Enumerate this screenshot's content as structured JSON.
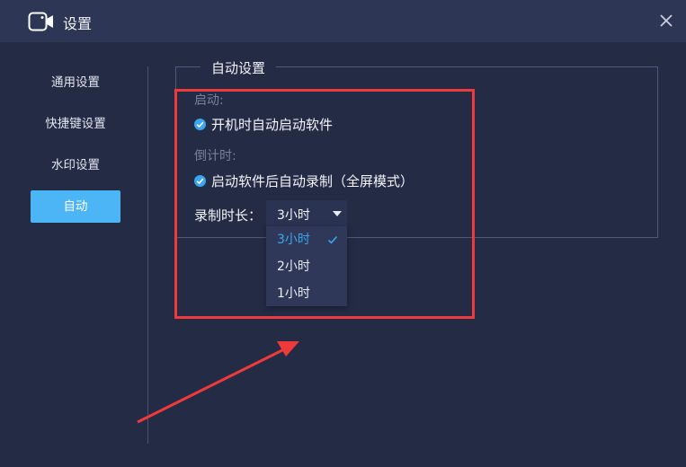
{
  "window": {
    "title": "设置",
    "icon": "video-camera-icon",
    "close_icon": "close-icon"
  },
  "sidebar": {
    "items": [
      {
        "label": "通用设置",
        "active": false
      },
      {
        "label": "快捷键设置",
        "active": false
      },
      {
        "label": "水印设置",
        "active": false
      },
      {
        "label": "自动",
        "active": true
      }
    ]
  },
  "auto_settings": {
    "legend": "自动设置",
    "startup": {
      "section_label": "启动:",
      "option_label": "开机时自动启动软件",
      "checked": true
    },
    "countdown": {
      "section_label": "倒计时:",
      "option_label": "启动软件后自动录制（全屏模式）",
      "checked": true
    },
    "duration": {
      "label": "录制时长：",
      "selected": "3小时",
      "options": [
        "3小时",
        "2小时",
        "1小时"
      ],
      "selected_index": 0
    }
  },
  "colors": {
    "background": "#232b45",
    "titlebar": "#2d3655",
    "accent": "#4cb5f5",
    "annotation": "#ee3a3a"
  }
}
